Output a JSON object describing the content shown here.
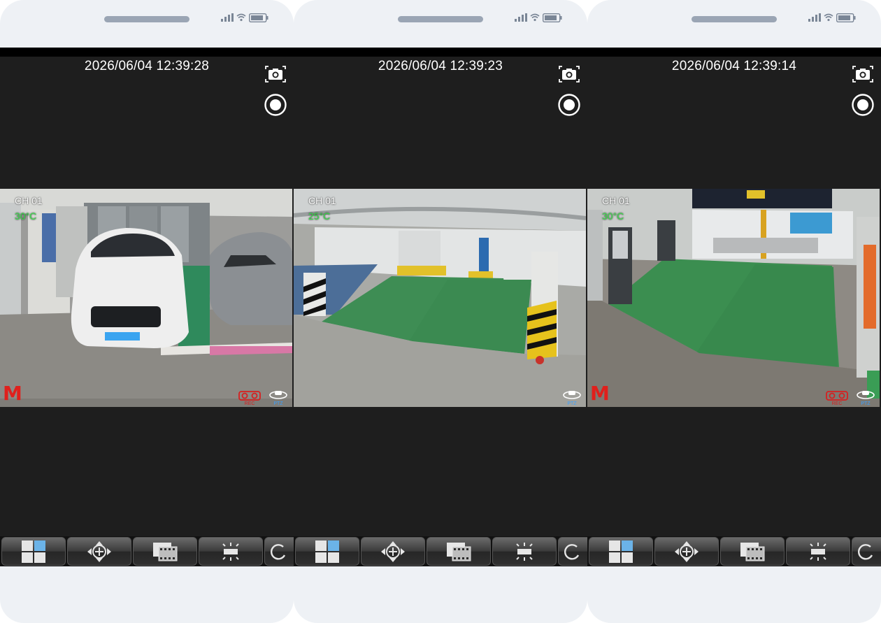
{
  "panels": [
    {
      "timestamp": "2026/06/04 12:39:28",
      "channel": "CH 01",
      "temperature": "30°C",
      "mode_badge": "M",
      "rec_label": "REC",
      "ptz_label": "PTZ",
      "scene": "white-car-garage"
    },
    {
      "timestamp": "2026/06/04 12:39:23",
      "channel": "CH 01",
      "temperature": "25°C",
      "mode_badge": "",
      "rec_label": "",
      "ptz_label": "PTZ",
      "scene": "ev-charging-bays"
    },
    {
      "timestamp": "2026/06/04 12:39:14",
      "channel": "CH 01",
      "temperature": "30°C",
      "mode_badge": "M",
      "rec_label": "REC",
      "ptz_label": "PTZ",
      "scene": "ev-charging-bays-wide"
    }
  ],
  "toolbar": {
    "buttons": [
      {
        "icon": "grid-layout-icon"
      },
      {
        "icon": "ptz-move-icon"
      },
      {
        "icon": "playback-film-icon"
      },
      {
        "icon": "brightness-icon"
      },
      {
        "icon": "rotate-icon"
      }
    ]
  },
  "colors": {
    "screen_bg": "#1e1e1e",
    "timestamp_text": "#ffffff",
    "temperature_text": "#39e04a",
    "mode_badge": "#e0201c",
    "ev_bay_green": "#3e8d54",
    "device_frame": "#eef1f5"
  }
}
